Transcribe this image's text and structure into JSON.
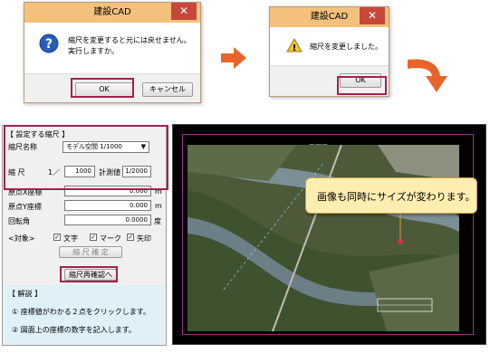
{
  "dialog1": {
    "title": "建設CAD",
    "close_label": "✕",
    "message_line1": "縮尺を変更すると元には戻せません。",
    "message_line2": "実行しますか。",
    "ok_label": "OK",
    "cancel_label": "キャンセル"
  },
  "dialog2": {
    "title": "建設CAD",
    "close_label": "✕",
    "message": "縮尺を変更しました。",
    "ok_label": "OK"
  },
  "panel": {
    "section_title": "【 設定する縮尺 】",
    "scale_name_label": "縮尺名称",
    "scale_name_value": "モデル空間 1/1000",
    "scale_label": "縮  尺",
    "ratio_prefix": "1／",
    "ratio_value": "1000",
    "measured_label": "計測値",
    "measured_value": "1/2000",
    "origin_x_label": "原点X座標",
    "origin_x_value": "0.000",
    "origin_x_unit": "m",
    "origin_y_label": "原点Y座標",
    "origin_y_value": "0.000",
    "origin_y_unit": "m",
    "rotation_label": "回転角",
    "rotation_value": "0.0000",
    "rotation_unit": "度",
    "target_label": "<対象>",
    "chk_text": "文字",
    "chk_mark": "マーク",
    "chk_arrow": "矢印",
    "confirm_scale_label": "縮 尺 確 定",
    "recheck_label": "縮尺再確認へ",
    "help_title": "【 解説 】",
    "help_1": "① 座標値がわかる２点をクリックします。",
    "help_2": "② 図面上の座標の数字を記入します。"
  },
  "canvas": {
    "title": "平面図",
    "callout": "画像も同時にサイズが変わります。"
  },
  "colors": {
    "accent_red": "#a3214f",
    "arrow_orange": "#e8642a",
    "callout_yellow": "#ffeeb0"
  }
}
